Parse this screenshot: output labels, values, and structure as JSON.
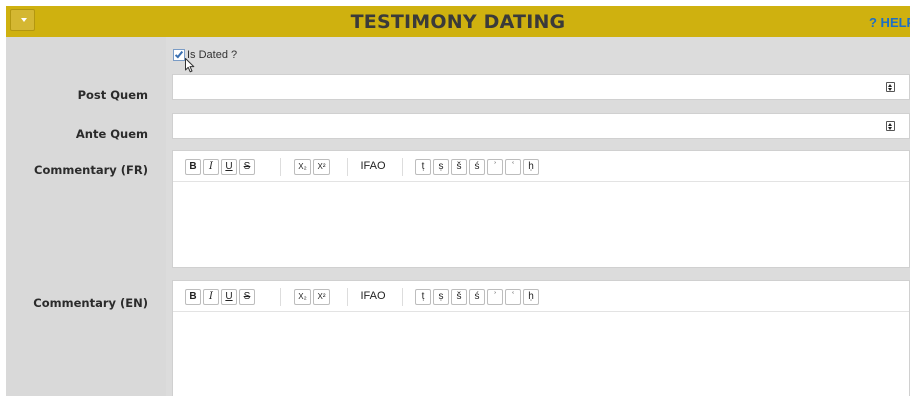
{
  "header": {
    "title": "TESTIMONY DATING",
    "help_label": "? HELP"
  },
  "is_dated": {
    "label": "Is Dated ?",
    "checked": true
  },
  "fields": {
    "post_quem": {
      "label": "Post Quem",
      "value": ""
    },
    "ante_quem": {
      "label": "Ante Quem",
      "value": ""
    }
  },
  "toolbar": {
    "bold": "B",
    "italic": "I",
    "underline": "U",
    "strikethrough": "S",
    "subscript": "X₂",
    "superscript": "X²",
    "ifao": "IFAO",
    "chars": [
      "ṭ",
      "ṣ",
      "š",
      "ś",
      "ʾ",
      "ʿ",
      "ḥ"
    ]
  },
  "commentary": {
    "fr": {
      "label": "Commentary (FR)",
      "content": ""
    },
    "en": {
      "label": "Commentary (EN)",
      "content": ""
    }
  },
  "icons": {
    "collapse": "chevron-down-icon",
    "spinner": "spinner-icon",
    "cursor": "mouse-cursor-icon"
  },
  "colors": {
    "header_bg": "#cfb10f",
    "panel_bg": "#dcdcdc",
    "help_link": "#1e6fc5"
  }
}
